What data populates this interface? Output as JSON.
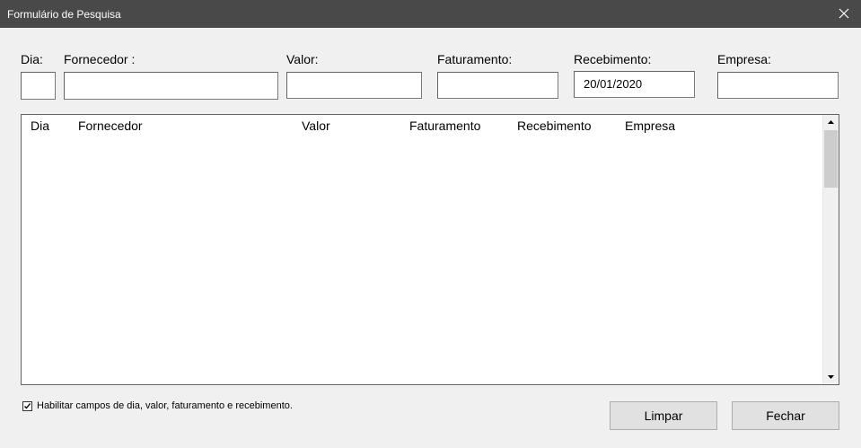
{
  "window": {
    "title": "Formulário de Pesquisa"
  },
  "labels": {
    "dia": "Dia:",
    "fornecedor": "Fornecedor :",
    "valor": "Valor:",
    "faturamento": "Faturamento:",
    "recebimento": "Recebimento:",
    "empresa": "Empresa:"
  },
  "fields": {
    "dia": "",
    "fornecedor": "",
    "valor": "",
    "faturamento": "",
    "recebimento": "20/01/2020",
    "empresa": ""
  },
  "list": {
    "columns": [
      "Dia",
      "Fornecedor",
      "Valor",
      "Faturamento",
      "Recebimento",
      "Empresa"
    ],
    "rows": []
  },
  "checkbox": {
    "label": "Habilitar campos de dia, valor, faturamento e recebimento.",
    "checked": true
  },
  "buttons": {
    "limpar": "Limpar",
    "fechar": "Fechar"
  }
}
